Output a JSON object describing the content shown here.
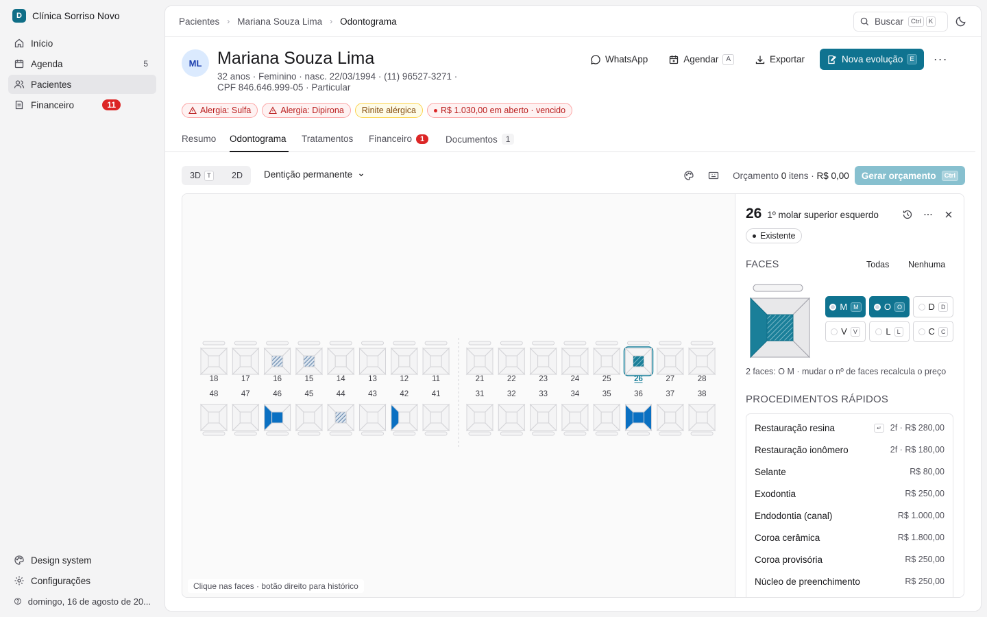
{
  "sidebar": {
    "brand_letter": "D",
    "brand_name": "Clínica Sorriso Novo",
    "items": [
      {
        "label": "Início",
        "icon": "home-icon"
      },
      {
        "label": "Agenda",
        "icon": "calendar-icon",
        "count": "5"
      },
      {
        "label": "Pacientes",
        "icon": "users-icon",
        "active": true
      },
      {
        "label": "Financeiro",
        "icon": "receipt-icon",
        "badge": "11"
      }
    ],
    "bottom": [
      {
        "label": "Design system",
        "icon": "palette-icon"
      },
      {
        "label": "Configurações",
        "icon": "gear-icon"
      },
      {
        "label": "domingo, 16 de agosto de 20...",
        "icon": "help-circle-icon"
      }
    ]
  },
  "breadcrumb": [
    "Pacientes",
    "Mariana Souza Lima",
    "Odontograma"
  ],
  "search": {
    "label": "Buscar",
    "kbd1": "Ctrl",
    "kbd2": "K"
  },
  "patient": {
    "initials": "ML",
    "name": "Mariana Souza Lima",
    "meta_line1": "32 anos · Feminino · nasc. 22/03/1994 · (11) 96527-3271 ·",
    "meta_line2": "CPF 846.646.999-05 · Particular"
  },
  "actions": {
    "whatsapp": "WhatsApp",
    "agendar": "Agendar",
    "agendar_kbd": "A",
    "exportar": "Exportar",
    "nova": "Nova evolução",
    "nova_kbd": "E",
    "more": "···"
  },
  "badges": [
    {
      "label": "Alergia: Sulfa",
      "kind": "red",
      "icon": "warning-icon"
    },
    {
      "label": "Alergia: Dipirona",
      "kind": "red",
      "icon": "warning-icon"
    },
    {
      "label": "Rinite alérgica",
      "kind": "yellow"
    },
    {
      "label": "R$ 1.030,00 em aberto · vencido",
      "kind": "red",
      "icon": "dot-icon"
    }
  ],
  "tabs": [
    {
      "label": "Resumo"
    },
    {
      "label": "Odontograma",
      "active": true
    },
    {
      "label": "Tratamentos"
    },
    {
      "label": "Financeiro",
      "badge": "1"
    },
    {
      "label": "Documentos",
      "count": "1"
    }
  ],
  "toolbar": {
    "view3d": "3D",
    "view3d_kbd": "T",
    "view2d": "2D",
    "dentition": "Dentição permanente",
    "orcamento_label": "Orçamento",
    "orcamento_count": "0",
    "orcamento_items": "itens ·",
    "orcamento_total": "R$ 0,00",
    "gerar": "Gerar orçamento",
    "gerar_kbd": "Ctrl"
  },
  "odontogram": {
    "upper_right": [
      "18",
      "17",
      "16",
      "15",
      "14",
      "13",
      "12",
      "11"
    ],
    "upper_left": [
      "21",
      "22",
      "23",
      "24",
      "25",
      "26",
      "27",
      "28"
    ],
    "lower_right": [
      "48",
      "47",
      "46",
      "45",
      "44",
      "43",
      "42",
      "41"
    ],
    "lower_left": [
      "31",
      "32",
      "33",
      "34",
      "35",
      "36",
      "37",
      "38"
    ],
    "hatched": [
      "16",
      "15",
      "26",
      "44"
    ],
    "filled_oclusal": [
      "46",
      "36"
    ],
    "filled_left": [
      "46",
      "42",
      "36"
    ],
    "filled_right": [
      "36"
    ],
    "selected": "26",
    "hint": "Clique nas faces · botão direito para histórico"
  },
  "panel": {
    "tooth_number": "26",
    "tooth_name": "1º molar superior esquerdo",
    "status": "Existente",
    "faces_label": "FACES",
    "faces_all": "Todas",
    "faces_none": "Nenhuma",
    "faces": [
      {
        "label": "M",
        "kbd": "M",
        "on": true
      },
      {
        "label": "O",
        "kbd": "O",
        "on": true
      },
      {
        "label": "D",
        "kbd": "D",
        "on": false
      },
      {
        "label": "V",
        "kbd": "V",
        "on": false
      },
      {
        "label": "L",
        "kbd": "L",
        "on": false
      },
      {
        "label": "C",
        "kbd": "C",
        "on": false
      }
    ],
    "faces_note": "2 faces: O M · mudar o nº de faces recalcula o preço",
    "proc_label": "PROCEDIMENTOS RÁPIDOS",
    "procedures": [
      {
        "name": "Restauração resina",
        "price": "2f · R$ 280,00",
        "kbd": "↵"
      },
      {
        "name": "Restauração ionômero",
        "price": "2f · R$ 180,00"
      },
      {
        "name": "Selante",
        "price": "R$ 80,00"
      },
      {
        "name": "Exodontia",
        "price": "R$ 250,00"
      },
      {
        "name": "Endodontia (canal)",
        "price": "R$ 1.000,00"
      },
      {
        "name": "Coroa cerâmica",
        "price": "R$ 1.800,00"
      },
      {
        "name": "Coroa provisória",
        "price": "R$ 250,00"
      },
      {
        "name": "Núcleo de preenchimento",
        "price": "R$ 250,00"
      }
    ]
  },
  "colors": {
    "accent": "#0f7390",
    "fill_blue": "#0a70c2",
    "hatch": "#5b7fa6",
    "selected": "#1a7f99"
  }
}
